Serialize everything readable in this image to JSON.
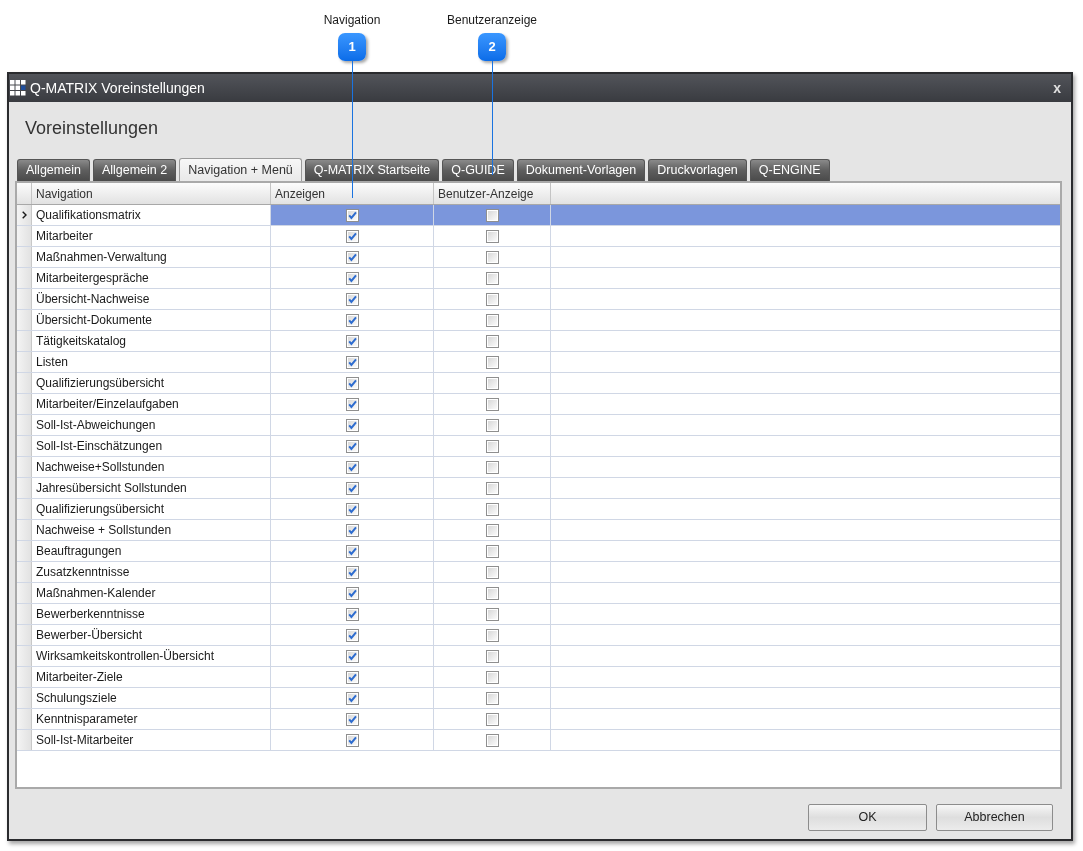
{
  "annotations": [
    {
      "label": "Navigation",
      "number": "1"
    },
    {
      "label": "Benutzeranzeige",
      "number": "2"
    }
  ],
  "window": {
    "title": "Q-MATRIX Voreinstellungen",
    "close": "x"
  },
  "heading": "Voreinstellungen",
  "tabs": [
    {
      "label": "Allgemein",
      "selected": false
    },
    {
      "label": "Allgemein 2",
      "selected": false
    },
    {
      "label": "Navigation + Menü",
      "selected": true
    },
    {
      "label": "Q-MATRIX Startseite",
      "selected": false
    },
    {
      "label": "Q-GUIDE",
      "selected": false
    },
    {
      "label": "Dokument-Vorlagen",
      "selected": false
    },
    {
      "label": "Druckvorlagen",
      "selected": false
    },
    {
      "label": "Q-ENGINE",
      "selected": false
    }
  ],
  "table": {
    "columns": [
      "Navigation",
      "Anzeigen",
      "Benutzer-Anzeige"
    ],
    "rows": [
      {
        "name": "Qualifikationsmatrix",
        "show": true,
        "user_display": false,
        "selected": true
      },
      {
        "name": "Mitarbeiter",
        "show": true,
        "user_display": false,
        "selected": false
      },
      {
        "name": "Maßnahmen-Verwaltung",
        "show": true,
        "user_display": false,
        "selected": false
      },
      {
        "name": "Mitarbeitergespräche",
        "show": true,
        "user_display": false,
        "selected": false
      },
      {
        "name": "Übersicht-Nachweise",
        "show": true,
        "user_display": false,
        "selected": false
      },
      {
        "name": "Übersicht-Dokumente",
        "show": true,
        "user_display": false,
        "selected": false
      },
      {
        "name": "Tätigkeitskatalog",
        "show": true,
        "user_display": false,
        "selected": false
      },
      {
        "name": "Listen",
        "show": true,
        "user_display": false,
        "selected": false
      },
      {
        "name": "Qualifizierungsübersicht",
        "show": true,
        "user_display": false,
        "selected": false
      },
      {
        "name": "Mitarbeiter/Einzelaufgaben",
        "show": true,
        "user_display": false,
        "selected": false
      },
      {
        "name": "Soll-Ist-Abweichungen",
        "show": true,
        "user_display": false,
        "selected": false
      },
      {
        "name": "Soll-Ist-Einschätzungen",
        "show": true,
        "user_display": false,
        "selected": false
      },
      {
        "name": "Nachweise+Sollstunden",
        "show": true,
        "user_display": false,
        "selected": false
      },
      {
        "name": "Jahresübersicht Sollstunden",
        "show": true,
        "user_display": false,
        "selected": false
      },
      {
        "name": "Qualifizierungsübersicht",
        "show": true,
        "user_display": false,
        "selected": false
      },
      {
        "name": "Nachweise + Sollstunden",
        "show": true,
        "user_display": false,
        "selected": false
      },
      {
        "name": "Beauftragungen",
        "show": true,
        "user_display": false,
        "selected": false
      },
      {
        "name": "Zusatzkenntnisse",
        "show": true,
        "user_display": false,
        "selected": false
      },
      {
        "name": "Maßnahmen-Kalender",
        "show": true,
        "user_display": false,
        "selected": false
      },
      {
        "name": "Bewerberkenntnisse",
        "show": true,
        "user_display": false,
        "selected": false
      },
      {
        "name": "Bewerber-Übersicht",
        "show": true,
        "user_display": false,
        "selected": false
      },
      {
        "name": "Wirksamkeitskontrollen-Übersicht",
        "show": true,
        "user_display": false,
        "selected": false
      },
      {
        "name": "Mitarbeiter-Ziele",
        "show": true,
        "user_display": false,
        "selected": false
      },
      {
        "name": "Schulungsziele",
        "show": true,
        "user_display": false,
        "selected": false
      },
      {
        "name": "Kenntnisparameter",
        "show": true,
        "user_display": false,
        "selected": false
      },
      {
        "name": "Soll-Ist-Mitarbeiter",
        "show": true,
        "user_display": false,
        "selected": false
      }
    ]
  },
  "buttons": [
    "OK",
    "Abbrechen"
  ]
}
